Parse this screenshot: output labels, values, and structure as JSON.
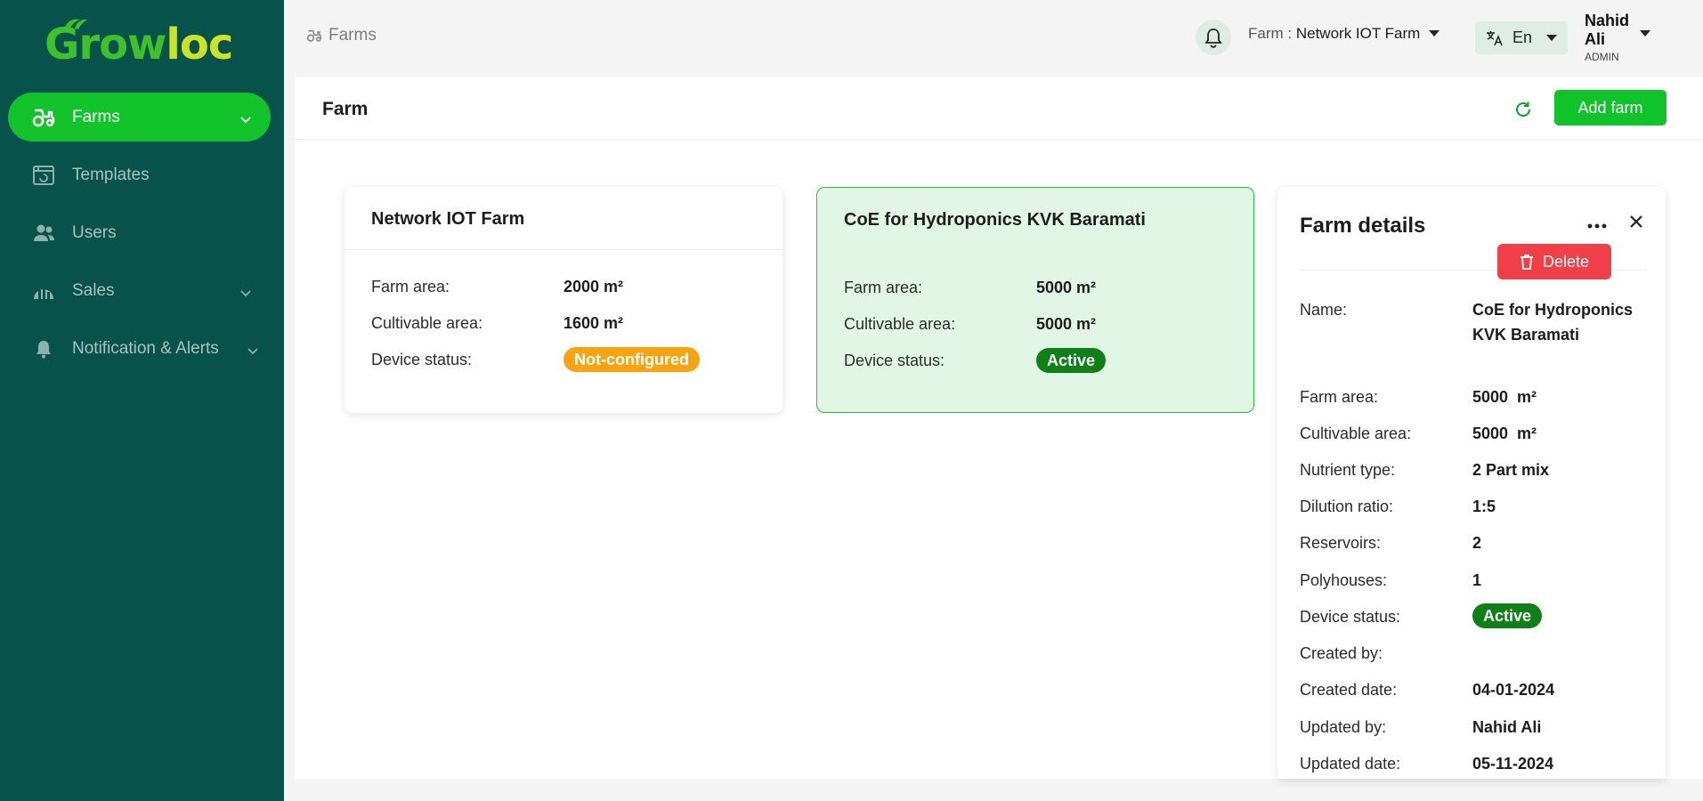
{
  "brand": {
    "logo_text_a": "Grow",
    "logo_text_b": "loc",
    "accent": "#13c32c",
    "sidebar_bg": "#07524a"
  },
  "sidebar": {
    "items": [
      {
        "label": "Farms",
        "icon": "tractor-icon",
        "active": true,
        "has_chevron": true
      },
      {
        "label": "Templates",
        "icon": "template-icon",
        "active": false,
        "has_chevron": false
      },
      {
        "label": "Users",
        "icon": "users-icon",
        "active": false,
        "has_chevron": false
      },
      {
        "label": "Sales",
        "icon": "sales-chart-icon",
        "active": false,
        "has_chevron": true
      },
      {
        "label": "Notification & Alerts",
        "icon": "bell-icon",
        "active": false,
        "has_chevron": true
      }
    ]
  },
  "header": {
    "breadcrumb": "Farms",
    "farm_label": "Farm : ",
    "farm_value": "Network IOT Farm",
    "language": "En",
    "user_first": "Nahid",
    "user_last": "Ali",
    "user_role": "ADMIN"
  },
  "main": {
    "title": "Farm",
    "add_label": "Add farm"
  },
  "cards": [
    {
      "title": "Network IOT Farm",
      "farm_area_label": "Farm area:",
      "farm_area": "2000 m²",
      "cultivable_label": "Cultivable area:",
      "cultivable": "1600 m²",
      "status_label": "Device status:",
      "status": "Not-configured",
      "status_color": "#f8a30f"
    },
    {
      "title": "CoE for Hydroponics KVK Baramati",
      "farm_area_label": "Farm area:",
      "farm_area": "5000 m²",
      "cultivable_label": "Cultivable area:",
      "cultivable": "5000 m²",
      "status_label": "Device status:",
      "status": "Active",
      "status_color": "#0f7f18"
    }
  ],
  "details": {
    "title": "Farm details",
    "delete_label": "Delete",
    "rows": [
      {
        "label": "Name:",
        "value": "CoE for Hydroponics KVK Baramati"
      },
      {
        "label": "Farm area:",
        "value": "5000  m²"
      },
      {
        "label": "Cultivable area:",
        "value": "5000  m²"
      },
      {
        "label": "Nutrient type:",
        "value": "2 Part mix"
      },
      {
        "label": "Dilution ratio:",
        "value": "1:5"
      },
      {
        "label": "Reservoirs:",
        "value": "2"
      },
      {
        "label": "Polyhouses:",
        "value": "1"
      },
      {
        "label": "Device status:",
        "value": "Active"
      },
      {
        "label": "Created by:",
        "value": ""
      },
      {
        "label": "Created date:",
        "value": "04-01-2024"
      },
      {
        "label": "Updated by:",
        "value": "Nahid Ali"
      },
      {
        "label": "Updated date:",
        "value": "05-11-2024"
      }
    ]
  }
}
